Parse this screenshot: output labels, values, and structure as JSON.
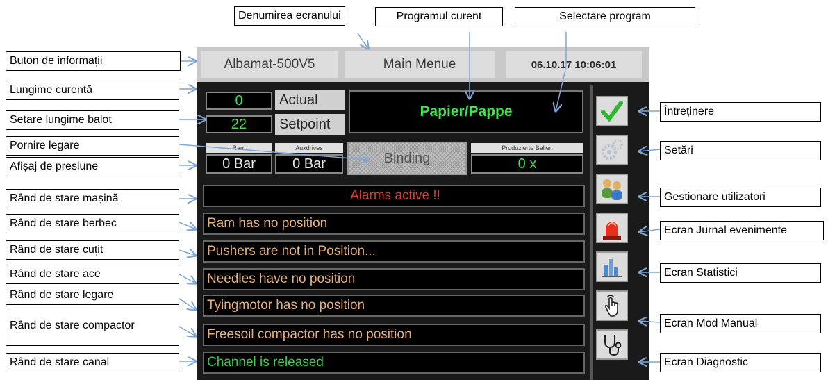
{
  "screen": {
    "header": {
      "machine_name": "Albamat-500V5",
      "screen_name": "Main Menue",
      "datetime": "06.10.17 10:06:01"
    },
    "length": {
      "actual_value": "0",
      "actual_label": "Actual",
      "setpoint_value": "22",
      "setpoint_label": "Setpoint"
    },
    "program": "Papier/Pappe",
    "pressure": {
      "ram_label": "Ram",
      "ram_value": "0 Bar",
      "aux_label": "Auxdrives",
      "aux_value": "0 Bar"
    },
    "binding_button": "Binding",
    "bales": {
      "label": "Produzierte Ballen",
      "value": "0 x"
    },
    "status_rows": [
      {
        "text": "Alarms active !!",
        "color": "#e23a2a"
      },
      {
        "text": "Ram has no position",
        "color": "#e8b078"
      },
      {
        "text": "Pushers are not in Position...",
        "color": "#e8b078"
      },
      {
        "text": "Needles have no position",
        "color": "#e8b078"
      },
      {
        "text": "Tyingmotor has no position",
        "color": "#e8b078"
      },
      {
        "text": "Freesoil compactor has no position",
        "color": "#e8b078"
      },
      {
        "text": "Channel is released",
        "color": "#33d145"
      }
    ],
    "side_icons": [
      "checkmark-icon",
      "gears-icon",
      "users-icon",
      "alarm-beacon-icon",
      "statistics-icon",
      "hand-pointer-icon",
      "stethoscope-icon"
    ]
  },
  "callouts": {
    "screen_name": "Denumirea ecranului",
    "current_program": "Programul curent",
    "program_select": "Selectare program",
    "info_button": "Buton de informații",
    "current_length": "Lungime curentă",
    "bale_length": "Setare lungime balot",
    "start_binding": "Pornire legare",
    "pressure_display": "Afișaj de presiune",
    "machine_status": "Rând de stare mașină",
    "ram_status": "Rând de stare berbec",
    "knife_status": "Rând de stare cuțit",
    "needle_status": "Rând de stare ace",
    "binding_status": "Rând de stare legare",
    "compactor_status": "Rând de stare compactor",
    "channel_status": "Rând de stare canal",
    "maintenance": "Întreținere",
    "settings": "Setări",
    "user_management": "Gestionare utilizatori",
    "event_log": "Ecran Jurnal evenimente",
    "statistics": "Ecran Statistici",
    "manual_mode": "Ecran Mod Manual",
    "diagnostic": "Ecran Diagnostic"
  },
  "colors": {
    "program_green": "#3fe14f",
    "arrow_blue": "#7ea6d6"
  }
}
